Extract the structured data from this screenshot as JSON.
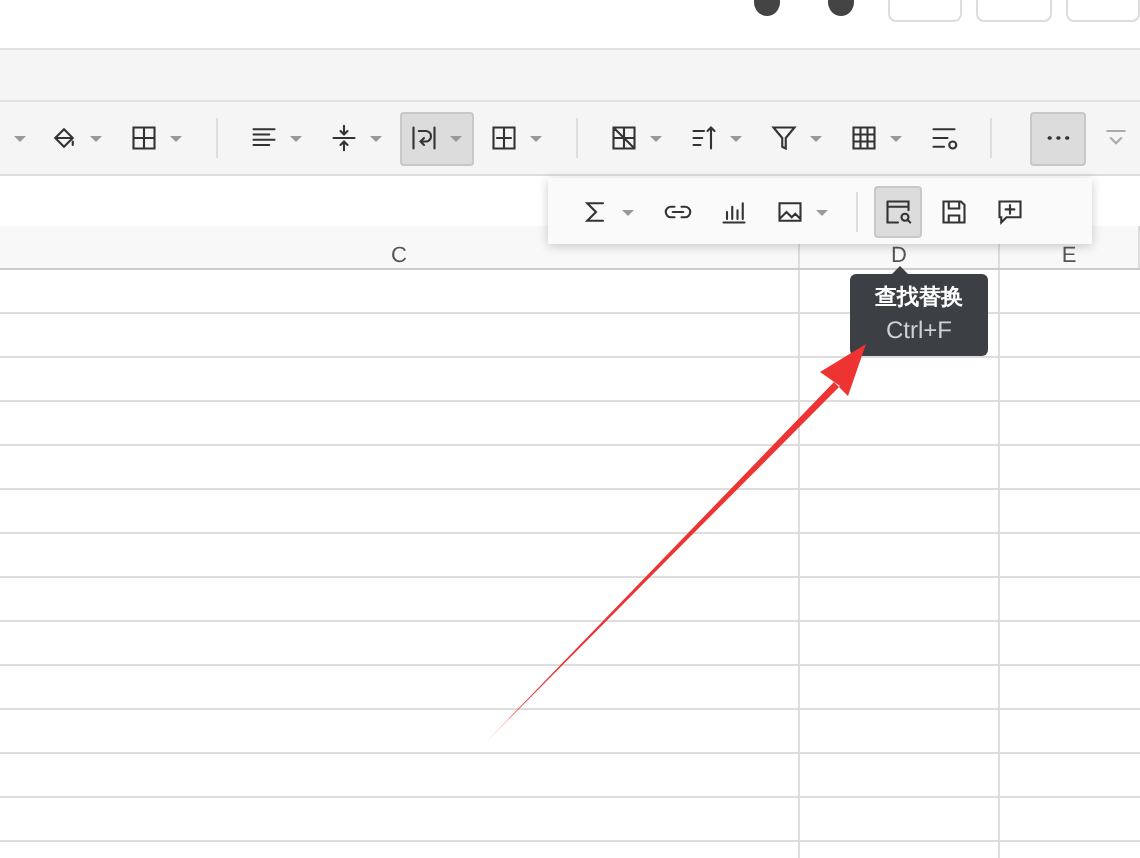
{
  "main_toolbar": [
    [
      {
        "kind": "partial",
        "dropdown": true,
        "selected": false
      },
      {
        "kind": "fill",
        "dropdown": true,
        "selected": false
      },
      {
        "kind": "border",
        "dropdown": true,
        "selected": false
      }
    ],
    [
      {
        "kind": "align",
        "dropdown": true,
        "selected": false
      },
      {
        "kind": "valign",
        "dropdown": true,
        "selected": false
      },
      {
        "kind": "wrap",
        "dropdown": true,
        "selected": true
      },
      {
        "kind": "merge",
        "dropdown": true,
        "selected": false
      }
    ],
    [
      {
        "kind": "freeze",
        "dropdown": true,
        "selected": false
      },
      {
        "kind": "sort",
        "dropdown": true,
        "selected": false
      },
      {
        "kind": "filter",
        "dropdown": true,
        "selected": false
      },
      {
        "kind": "table",
        "dropdown": true,
        "selected": false
      },
      {
        "kind": "cond",
        "dropdown": false,
        "selected": false
      }
    ],
    [
      {
        "kind": "more",
        "dropdown": false,
        "selected": true
      },
      {
        "kind": "collapse",
        "dropdown": false,
        "selected": false
      }
    ]
  ],
  "floating_toolbar": [
    [
      {
        "kind": "sum",
        "dropdown": true,
        "selected": false
      },
      {
        "kind": "link",
        "dropdown": false,
        "selected": false
      },
      {
        "kind": "chart",
        "dropdown": false,
        "selected": false
      },
      {
        "kind": "image",
        "dropdown": true,
        "selected": false
      }
    ],
    [
      {
        "kind": "find",
        "dropdown": false,
        "selected": true
      },
      {
        "kind": "save",
        "dropdown": false,
        "selected": false
      },
      {
        "kind": "comment",
        "dropdown": false,
        "selected": false
      }
    ]
  ],
  "tooltip": {
    "title": "查找替换",
    "shortcut": "Ctrl+F"
  },
  "columns": [
    {
      "label": "C"
    },
    {
      "label": "D"
    },
    {
      "label": "E"
    }
  ]
}
